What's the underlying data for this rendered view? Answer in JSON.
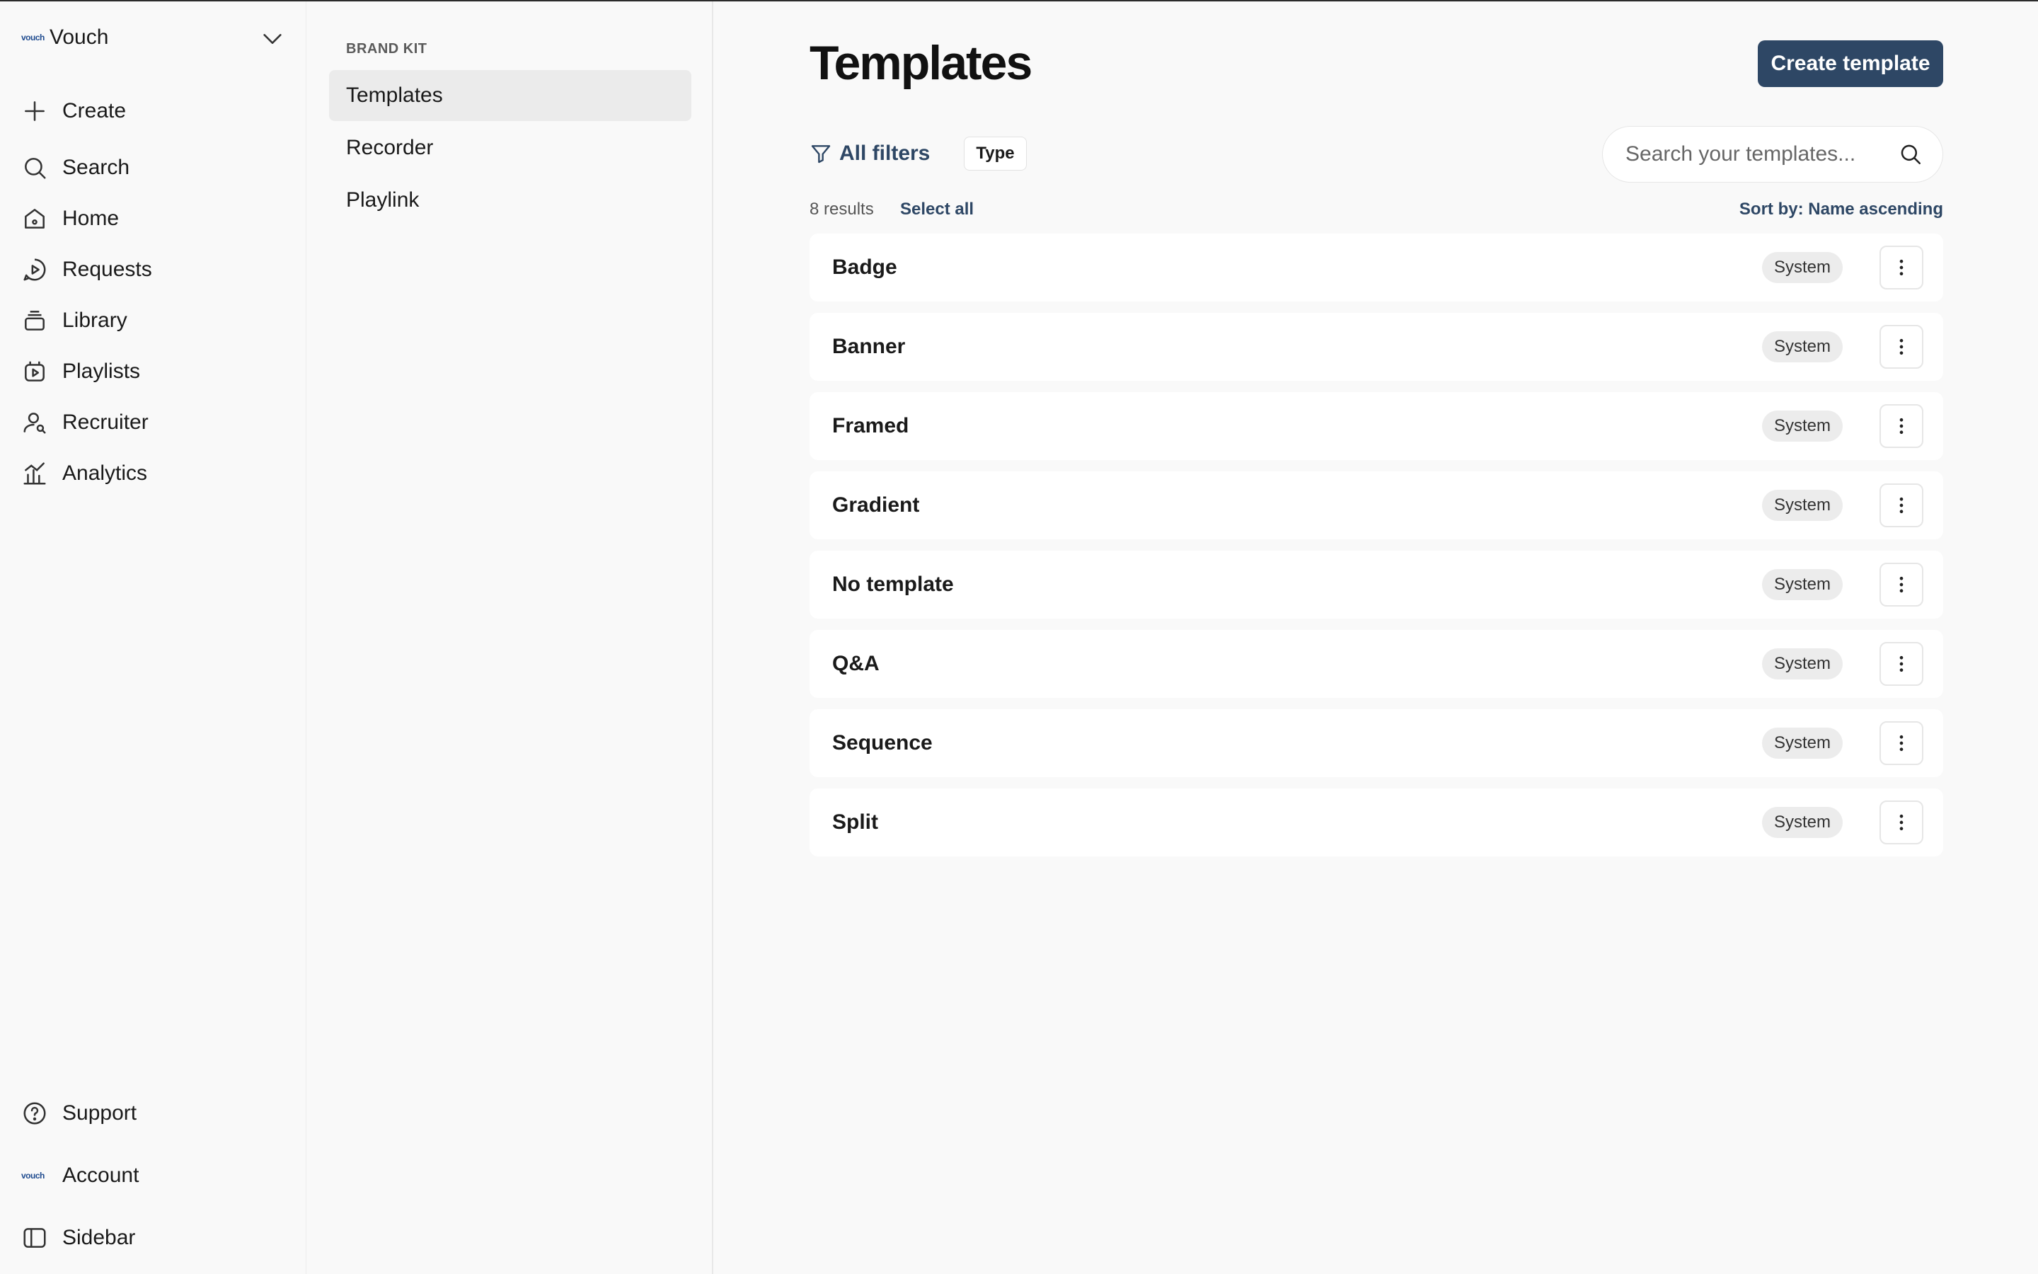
{
  "workspace": {
    "logo_text": "vouch",
    "name": "Vouch"
  },
  "nav": {
    "items": [
      {
        "label": "Create",
        "icon": "plus-icon"
      },
      {
        "label": "Search",
        "icon": "search-icon"
      },
      {
        "label": "Home",
        "icon": "home-icon"
      },
      {
        "label": "Requests",
        "icon": "requests-icon"
      },
      {
        "label": "Library",
        "icon": "library-icon"
      },
      {
        "label": "Playlists",
        "icon": "playlists-icon"
      },
      {
        "label": "Recruiter",
        "icon": "recruiter-icon"
      },
      {
        "label": "Analytics",
        "icon": "analytics-icon"
      }
    ],
    "bottom": [
      {
        "label": "Support",
        "icon": "help-icon"
      },
      {
        "label": "Account",
        "icon": "account-logo-icon",
        "logo_text": "vouch"
      },
      {
        "label": "Sidebar",
        "icon": "sidebar-icon"
      }
    ]
  },
  "subnav": {
    "heading": "BRAND KIT",
    "items": [
      {
        "label": "Templates",
        "active": true
      },
      {
        "label": "Recorder",
        "active": false
      },
      {
        "label": "Playlink",
        "active": false
      }
    ]
  },
  "main": {
    "title": "Templates",
    "create_button": "Create template",
    "filters": {
      "all_filters": "All filters",
      "type_chip": "Type"
    },
    "search": {
      "placeholder": "Search your templates...",
      "value": ""
    },
    "results_count": "8 results",
    "select_all": "Select all",
    "sort": "Sort by: Name ascending",
    "templates": [
      {
        "name": "Badge",
        "badge": "System"
      },
      {
        "name": "Banner",
        "badge": "System"
      },
      {
        "name": "Framed",
        "badge": "System"
      },
      {
        "name": "Gradient",
        "badge": "System"
      },
      {
        "name": "No template",
        "badge": "System"
      },
      {
        "name": "Q&A",
        "badge": "System"
      },
      {
        "name": "Sequence",
        "badge": "System"
      },
      {
        "name": "Split",
        "badge": "System"
      }
    ]
  },
  "colors": {
    "accent": "#2e4765",
    "background": "#f9f9f9",
    "row_bg": "#ffffff",
    "badge_bg": "#ececec"
  }
}
